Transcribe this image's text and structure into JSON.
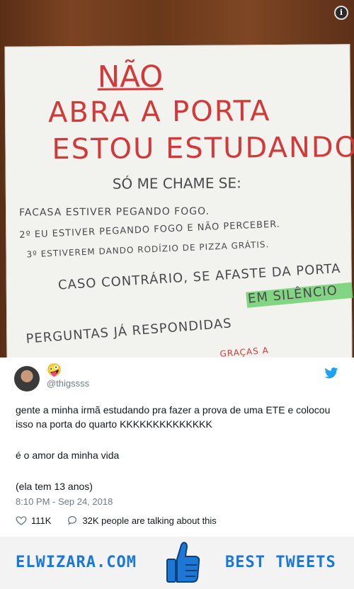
{
  "photo": {
    "info_label": "i",
    "sign": {
      "line_nao": "NÃO",
      "line_abra": "ABRA A PORTA",
      "line_estou": "ESTOU ESTUDANDO",
      "line_chame": "SÓ ME CHAME SE:",
      "item1": "FACASA ESTIVER PEGANDO FOGO.",
      "item2": "2º EU ESTIVER PEGANDO FOGO E NÃO PERCEBER.",
      "item3": "3º ESTIVEREM DANDO RODÍZIO DE PIZZA GRÁTIS.",
      "caso": "CASO CONTRÁRIO, SE AFASTE DA PORTA",
      "silencio": "EM SILÊNCIO",
      "perguntas": "PERGUNTAS JÁ RESPONDIDAS",
      "bottom": "GRAÇAS A"
    }
  },
  "tweet": {
    "emoji": "🤪",
    "handle": "@thigssss",
    "text_line1": "gente a minha irmã estudando pra fazer a prova de uma ETE e colocou isso na porta do quarto KKKKKKKKKKKKKK",
    "text_line2": "é o amor da minha vida",
    "text_line3": "(ela tem 13 anos)",
    "timestamp": "8:10 PM - Sep 24, 2018",
    "likes": "111K",
    "talking": "32K people are talking about this"
  },
  "banner": {
    "brand": "ELWIZARA.COM",
    "tagline": "BEST TWEETS",
    "accent": "#1b78d6"
  }
}
